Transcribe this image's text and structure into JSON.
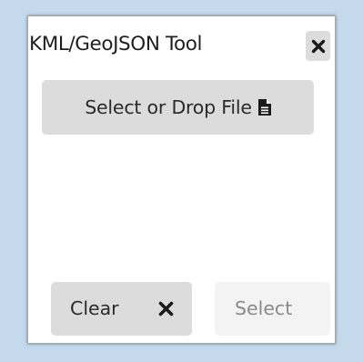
{
  "panel": {
    "title": "KML/GeoJSON Tool",
    "close_icon": "close-icon"
  },
  "file_input": {
    "label": "Select or Drop File",
    "icon": "file-icon"
  },
  "footer": {
    "clear_label": "Clear",
    "clear_icon": "close-icon",
    "select_label": "Select",
    "select_enabled": false
  },
  "colors": {
    "background": "#c4daec",
    "button": "#dcdcdc",
    "button_disabled": "#f3f3f3",
    "disabled_text": "#8a8a8a"
  }
}
